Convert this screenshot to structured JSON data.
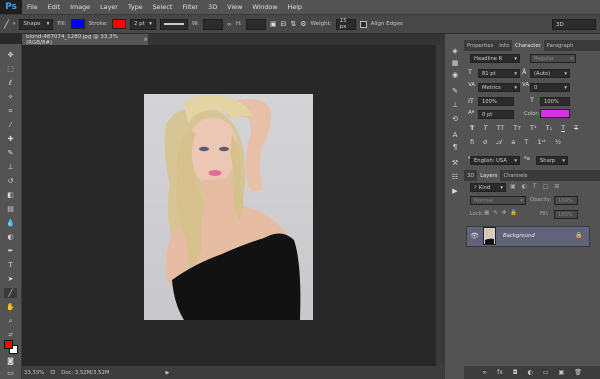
{
  "app": {
    "logo": "Ps"
  },
  "menu": [
    "File",
    "Edit",
    "Image",
    "Layer",
    "Type",
    "Select",
    "Filter",
    "3D",
    "View",
    "Window",
    "Help"
  ],
  "options": {
    "mode": "Shape",
    "fill_label": "Fill:",
    "fill_color": "#0000ff",
    "stroke_label": "Stroke:",
    "stroke_color": "#ff0000",
    "stroke_width": "2 pt",
    "w_label": "W:",
    "h_label": "H:",
    "weight_label": "Weight:",
    "weight_value": "15 px",
    "align_edges": "Align Edges",
    "workspace": "3D"
  },
  "document": {
    "tab_title": "blond-487074_1280.jpg @ 33,3% (RGB/8#)",
    "zoom": "33,33%",
    "doc_info": "Doc: 3,52M/3,52M"
  },
  "panels": {
    "tabs": [
      "Properties",
      "Info",
      "Character",
      "Paragraph"
    ],
    "active_tab": "Character",
    "font_family": "Headline R",
    "font_style": "Regular",
    "font_size": "81 pt",
    "leading": "(Auto)",
    "kerning": "Metrics",
    "tracking": "0",
    "vscale": "100%",
    "hscale": "100%",
    "baseline": "0 pt",
    "color_label": "Color:",
    "text_color": "#d633e0",
    "language": "English: USA",
    "antialias": "Sharp"
  },
  "layers": {
    "tabs": [
      "3D",
      "Layers",
      "Channels"
    ],
    "active_tab": "Layers",
    "kind": "Kind",
    "blend_mode": "Normal",
    "opacity_label": "Opacity:",
    "opacity": "100%",
    "lock_label": "Lock:",
    "fill_label": "Fill:",
    "fill": "100%",
    "items": [
      {
        "name": "Background"
      }
    ]
  }
}
